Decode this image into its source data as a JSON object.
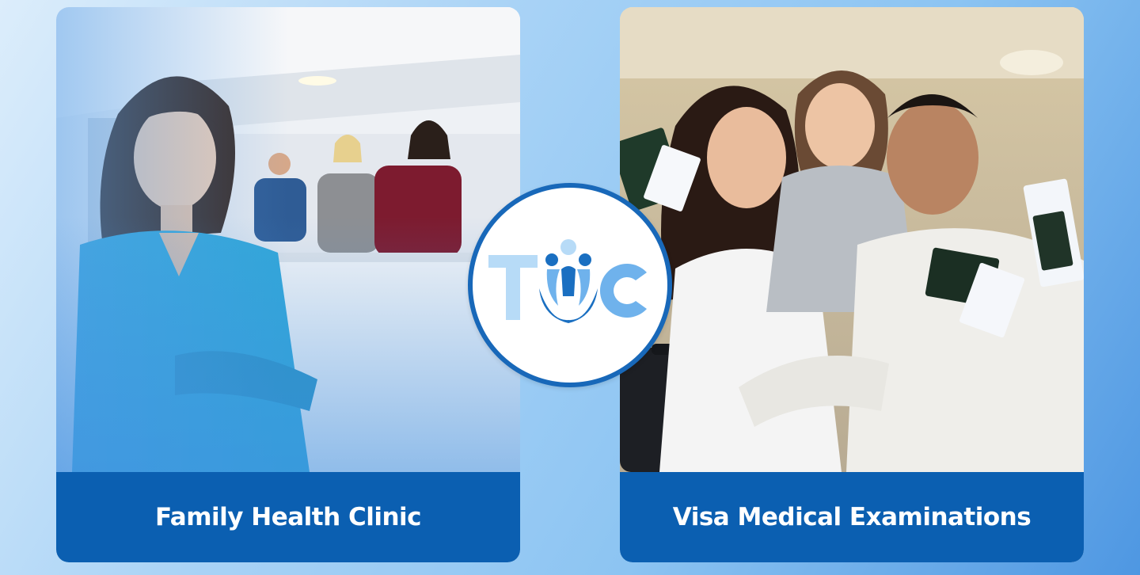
{
  "brand": {
    "logo_text": "TOC",
    "primary_color": "#0b5fb1",
    "logo_colors": [
      "#1a6fc1",
      "#6fb2ec",
      "#b7dbf7"
    ]
  },
  "cards": [
    {
      "label": "Family Health Clinic",
      "image": "clinic-reception-staff-photo"
    },
    {
      "label": "Visa Medical Examinations",
      "image": "family-with-passports-photo"
    }
  ]
}
